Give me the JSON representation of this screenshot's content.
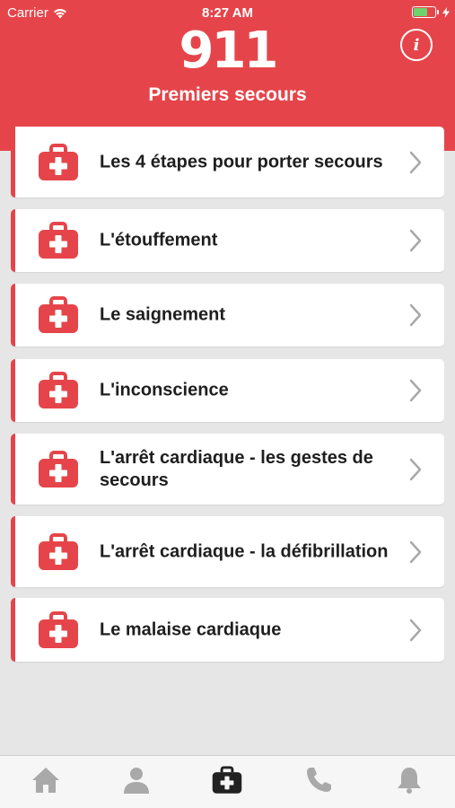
{
  "status_bar": {
    "carrier": "Carrier",
    "time": "8:27 AM",
    "battery_level": 0.7,
    "battery_color": "#6fd36b"
  },
  "header": {
    "logo": "911",
    "subtitle": "Premiers secours",
    "info_icon": "info-icon",
    "background": "#e5454a"
  },
  "items": [
    {
      "label": "Les 4 étapes pour porter secours",
      "icon": "first-aid-kit-icon"
    },
    {
      "label": "L'étouffement",
      "icon": "first-aid-kit-icon"
    },
    {
      "label": "Le saignement",
      "icon": "first-aid-kit-icon"
    },
    {
      "label": "L'inconscience",
      "icon": "first-aid-kit-icon"
    },
    {
      "label": "L'arrêt cardiaque - les gestes de secours",
      "icon": "first-aid-kit-icon"
    },
    {
      "label": "L'arrêt cardiaque - la défibrillation",
      "icon": "first-aid-kit-icon"
    },
    {
      "label": "Le malaise cardiaque",
      "icon": "first-aid-kit-icon"
    }
  ],
  "tabs": [
    {
      "icon": "home-icon",
      "active": false
    },
    {
      "icon": "person-icon",
      "active": false
    },
    {
      "icon": "first-aid-kit-icon",
      "active": true
    },
    {
      "icon": "phone-icon",
      "active": false
    },
    {
      "icon": "bell-icon",
      "active": false
    }
  ]
}
